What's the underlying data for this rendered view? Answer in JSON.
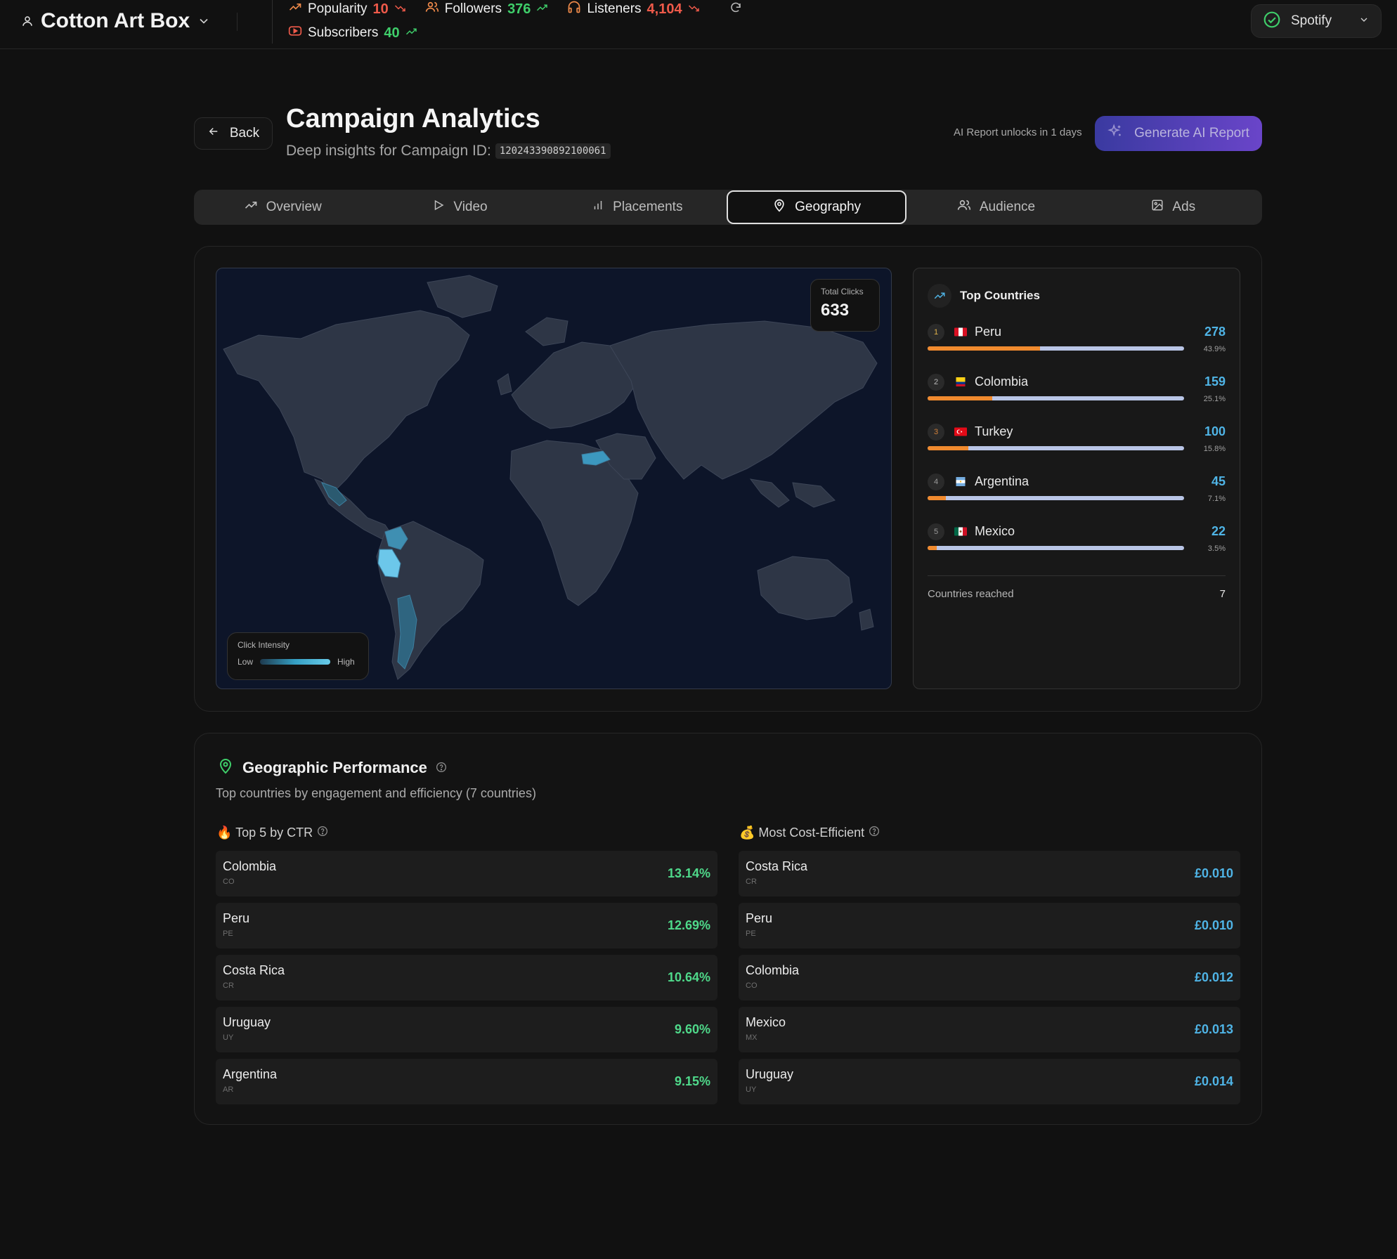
{
  "header": {
    "artist": "Cotton Art Box",
    "stats": [
      {
        "label": "Popularity",
        "value": "10",
        "trend": "down"
      },
      {
        "label": "Followers",
        "value": "376",
        "trend": "up"
      },
      {
        "label": "Listeners",
        "value": "4,104",
        "trend": "down"
      },
      {
        "label": "Subscribers",
        "value": "40",
        "trend": "up"
      }
    ],
    "platform": "Spotify"
  },
  "page": {
    "back_label": "Back",
    "title": "Campaign Analytics",
    "subtitle": "Deep insights for Campaign ID:",
    "campaign_id": "120243390892100061",
    "ai_note": "AI Report unlocks in 1 days",
    "ai_button": "Generate AI Report"
  },
  "tabs": [
    {
      "label": "Overview",
      "icon": "trend-icon",
      "active": false
    },
    {
      "label": "Video",
      "icon": "play-icon",
      "active": false
    },
    {
      "label": "Placements",
      "icon": "bar-chart-icon",
      "active": false
    },
    {
      "label": "Geography",
      "icon": "map-pin-icon",
      "active": true
    },
    {
      "label": "Audience",
      "icon": "users-icon",
      "active": false
    },
    {
      "label": "Ads",
      "icon": "image-icon",
      "active": false
    }
  ],
  "map": {
    "total_label": "Total Clicks",
    "total_value": "633",
    "legend_title": "Click Intensity",
    "legend_low": "Low",
    "legend_high": "High"
  },
  "top_countries": {
    "title": "Top Countries",
    "items": [
      {
        "rank": "1",
        "name": "Peru",
        "value": "278",
        "pct": "43.9%",
        "share": 0.439
      },
      {
        "rank": "2",
        "name": "Colombia",
        "value": "159",
        "pct": "25.1%",
        "share": 0.251
      },
      {
        "rank": "3",
        "name": "Turkey",
        "value": "100",
        "pct": "15.8%",
        "share": 0.158
      },
      {
        "rank": "4",
        "name": "Argentina",
        "value": "45",
        "pct": "7.1%",
        "share": 0.071
      },
      {
        "rank": "5",
        "name": "Mexico",
        "value": "22",
        "pct": "3.5%",
        "share": 0.035
      }
    ],
    "reached_label": "Countries reached",
    "reached_value": "7"
  },
  "performance": {
    "title": "Geographic Performance",
    "subtitle": "Top countries by engagement and efficiency (7 countries)",
    "ctr_title": "🔥 Top 5 by CTR",
    "ctr": [
      {
        "name": "Colombia",
        "code": "CO",
        "value": "13.14%"
      },
      {
        "name": "Peru",
        "code": "PE",
        "value": "12.69%"
      },
      {
        "name": "Costa Rica",
        "code": "CR",
        "value": "10.64%"
      },
      {
        "name": "Uruguay",
        "code": "UY",
        "value": "9.60%"
      },
      {
        "name": "Argentina",
        "code": "AR",
        "value": "9.15%"
      }
    ],
    "cost_title": "💰 Most Cost-Efficient",
    "cost": [
      {
        "name": "Costa Rica",
        "code": "CR",
        "value": "£0.010"
      },
      {
        "name": "Peru",
        "code": "PE",
        "value": "£0.010"
      },
      {
        "name": "Colombia",
        "code": "CO",
        "value": "£0.012"
      },
      {
        "name": "Mexico",
        "code": "MX",
        "value": "£0.013"
      },
      {
        "name": "Uruguay",
        "code": "UY",
        "value": "£0.014"
      }
    ]
  },
  "colors": {
    "accent_blue": "#4fb4e6",
    "accent_green": "#4fd98a",
    "bar_orange": "#f08a2e",
    "trend_red": "#ef5a4a",
    "trend_green": "#3fce6a"
  }
}
